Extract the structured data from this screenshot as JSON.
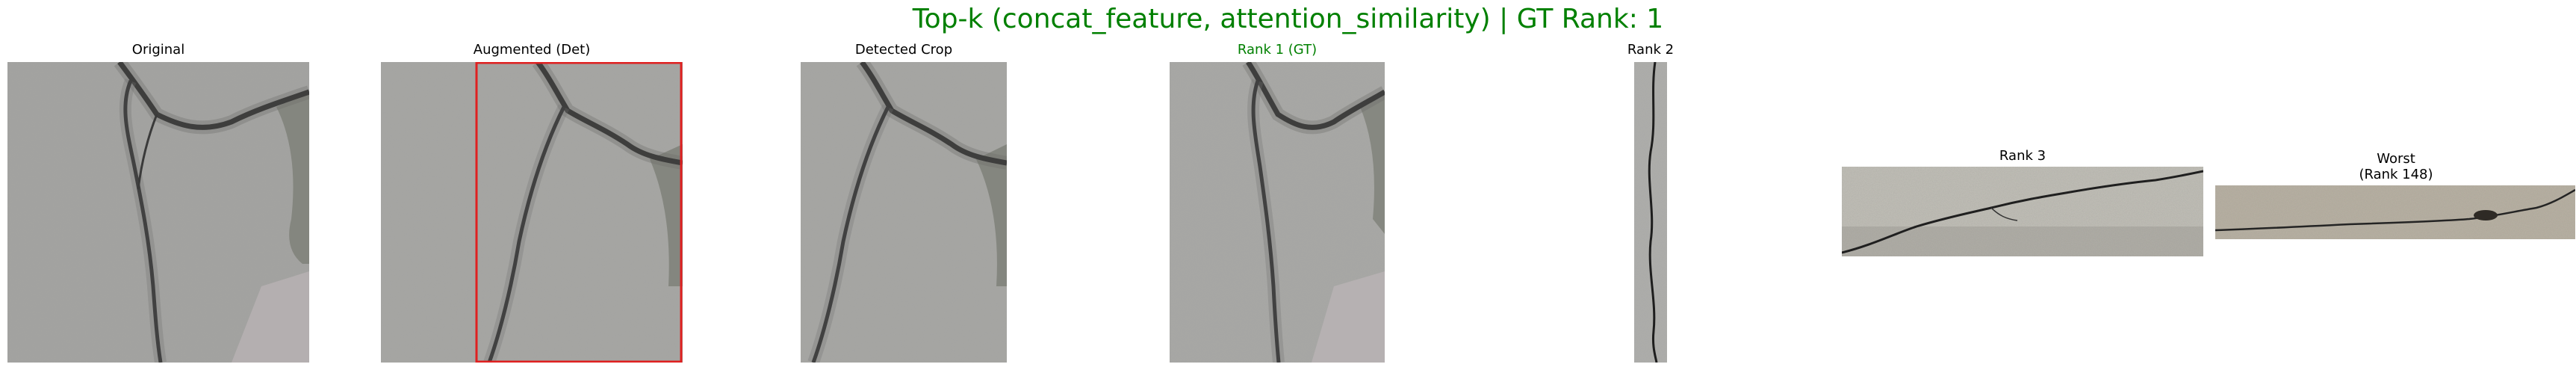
{
  "figure": {
    "title": "Top-k (concat_feature, attention_similarity) | GT Rank: 1",
    "title_color": "#008000"
  },
  "panels": [
    {
      "title": "Original"
    },
    {
      "title": "Augmented (Det)",
      "box_color": "#e02020"
    },
    {
      "title": "Detected Crop"
    },
    {
      "title": "Rank 1 (GT)",
      "title_color": "#008000"
    },
    {
      "title": "Rank 2"
    },
    {
      "title": "Rank 3"
    },
    {
      "title": "Worst\n(Rank 148)"
    }
  ],
  "colors": {
    "concrete_gray": "#a9a9a6",
    "crack_dark": "#2a2a2a",
    "beige_concrete": "#b9b2a4",
    "warm_concrete": "#c2c0b8"
  }
}
